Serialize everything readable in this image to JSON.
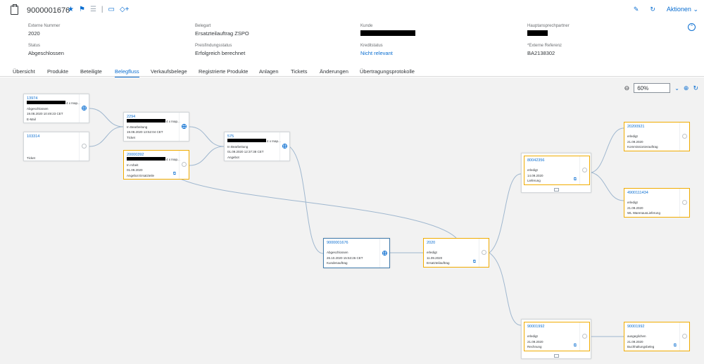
{
  "header": {
    "object_id": "9000001676",
    "actions_label": "Aktionen"
  },
  "attributes": {
    "externe_nummer": {
      "label": "Externe Nummer",
      "value": "2020"
    },
    "belegart": {
      "label": "Belegart",
      "value": "Ersatzteilauftrag ZSPO"
    },
    "kunde": {
      "label": "Kunde",
      "value": ""
    },
    "hauptansprechpartner": {
      "label": "Hauptansprechpartner",
      "value": ""
    },
    "status": {
      "label": "Status",
      "value": "Abgeschlossen"
    },
    "preisfindungsstatus": {
      "label": "Preisfindungsstatus",
      "value": "Erfolgreich berechnet"
    },
    "kreditstatus": {
      "label": "Kreditstatus",
      "value": "Nicht relevant"
    },
    "externe_referenz": {
      "label": "*Externe Referenz",
      "value": "BA2138302"
    }
  },
  "tabs": [
    {
      "label": "Übersicht"
    },
    {
      "label": "Produkte"
    },
    {
      "label": "Beteiligte"
    },
    {
      "label": "Belegfluss"
    },
    {
      "label": "Verkaufsbelege"
    },
    {
      "label": "Registrierte Produkte"
    },
    {
      "label": "Anlagen"
    },
    {
      "label": "Tickets"
    },
    {
      "label": "Änderungen"
    },
    {
      "label": "Übertragungsprotokolle"
    }
  ],
  "active_tab": "Belegfluss",
  "zoom": {
    "value": "60%"
  },
  "nodes": [
    {
      "id": "13974",
      "title_suffix": "4 x Inap...",
      "status": "Abgeschlossen",
      "date": "19.08.2020 10:49:23 CET",
      "type": "E-Mail"
    },
    {
      "id": "103314",
      "title_suffix": "",
      "status": "",
      "date": "",
      "type": "Ticket"
    },
    {
      "id": "2294",
      "title_suffix": "4 x Inap...",
      "status": "In Bearbeitung",
      "date": "19.08.2020 13:52:04 CET",
      "type": "Ticket"
    },
    {
      "id": "20000392",
      "title_suffix": "4 x Inap...",
      "status": "In Arbeit",
      "date": "01.09.2020",
      "type": "Angebot Ersatzteile"
    },
    {
      "id": "575",
      "title_suffix": "4 x Inap...",
      "status": "In Bearbeitung",
      "date": "01.09.2020 12:37:38 CET",
      "type": "Angebot"
    },
    {
      "id": "9000001676",
      "title_suffix": "",
      "status": "Abgeschlossen",
      "date": "26.10.2020 15:53:26 CET",
      "type": "Kundenauftrag"
    },
    {
      "id": "2020",
      "title_suffix": "",
      "status": "erledigt",
      "date": "11.09.2020",
      "type": "Ersatzteilauftrag"
    },
    {
      "id": "80042356",
      "title_suffix": "",
      "status": "erledigt",
      "date": "14.09.2020",
      "type": "Lieferung"
    },
    {
      "id": "20200921",
      "title_suffix": "",
      "status": "erledigt",
      "date": "21.09.2020",
      "type": "Kommissionierauftrag"
    },
    {
      "id": "4900111434",
      "title_suffix": "",
      "status": "erledigt",
      "date": "21.09.2020",
      "type": "WL WarenausLieferung"
    },
    {
      "id": "90001992",
      "title_suffix": "",
      "status": "erledigt",
      "date": "21.09.2020",
      "type": "Rechnung"
    },
    {
      "id": "90001992",
      "title_suffix": "",
      "status": "ausgeglichen",
      "date": "21.09.2020",
      "type": "Buchhaltungsbeleg"
    }
  ]
}
